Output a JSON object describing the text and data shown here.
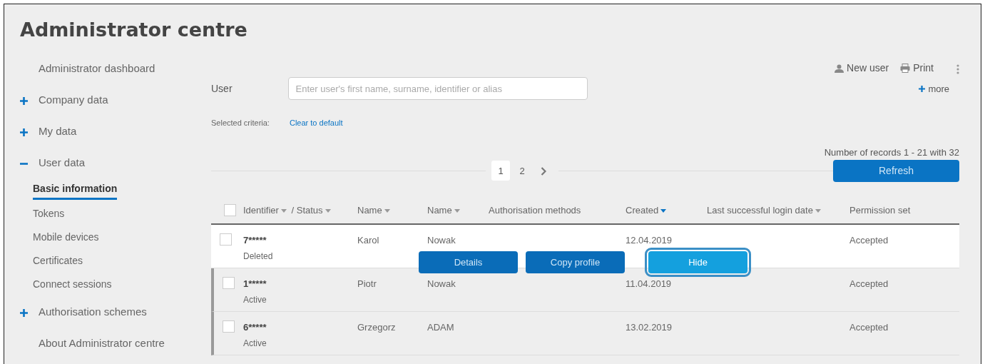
{
  "title": "Administrator centre",
  "sidebar": {
    "items": [
      {
        "kind": "link",
        "label": "Administrator dashboard"
      },
      {
        "kind": "group",
        "label": "Company data",
        "expanded": false
      },
      {
        "kind": "group",
        "label": "My data",
        "expanded": false
      },
      {
        "kind": "group",
        "label": "User data",
        "expanded": true,
        "children": [
          {
            "label": "Basic information",
            "selected": true
          },
          {
            "label": "Tokens",
            "selected": false
          },
          {
            "label": "Mobile devices",
            "selected": false
          },
          {
            "label": "Certificates",
            "selected": false
          },
          {
            "label": "Connect sessions",
            "selected": false
          }
        ]
      },
      {
        "kind": "group",
        "label": "Authorisation schemes",
        "expanded": false
      },
      {
        "kind": "link",
        "label": "About Administrator centre"
      }
    ]
  },
  "toolbar": {
    "actions": [
      {
        "kind": "user",
        "label": "New user"
      },
      {
        "kind": "print",
        "label": "Print"
      },
      {
        "kind": "menu"
      }
    ],
    "more": "more"
  },
  "filter": {
    "label": "User",
    "placeholder": "Enter user's first name, surname, identifier or alias",
    "criteria_label": "Selected criteria:",
    "clear_link": "Clear to default"
  },
  "records_info": "Number of records 1 - 21 with 32",
  "pagination": {
    "pages": [
      {
        "label": "1",
        "selected": true
      },
      {
        "label": "2",
        "selected": false
      }
    ]
  },
  "refresh_button": "Refresh",
  "table": {
    "select_all_checked": false,
    "columns": [
      {
        "parts": [
          {
            "label": "Identifier",
            "sortable": true,
            "sorted": false
          },
          {
            "label": "/ Status",
            "sortable": true,
            "sorted": false
          }
        ]
      },
      {
        "parts": [
          {
            "label": "Name",
            "sortable": true,
            "sorted": false
          }
        ]
      },
      {
        "parts": [
          {
            "label": "Name",
            "sortable": true,
            "sorted": false
          }
        ]
      },
      {
        "parts": [
          {
            "label": "Authorisation methods",
            "sortable": false,
            "sorted": false
          }
        ]
      },
      {
        "parts": [
          {
            "label": "Created",
            "sortable": true,
            "sorted": true
          }
        ]
      },
      {
        "parts": [
          {
            "label": "Last successful login date",
            "sortable": true,
            "sorted": false
          }
        ]
      },
      {
        "parts": [
          {
            "label": "Permission set",
            "sortable": false,
            "sorted": false
          }
        ]
      }
    ],
    "rows": [
      {
        "checked": false,
        "highlighted": true,
        "identifier": "7*****",
        "status": "Deleted",
        "first_name": "Karol",
        "last_name": "Nowak",
        "created": "12.04.2019",
        "permission_set": "Accepted"
      },
      {
        "checked": false,
        "highlighted": false,
        "identifier": "1*****",
        "status": "Active",
        "first_name": "Piotr",
        "last_name": "Nowak",
        "created": "11.04.2019",
        "permission_set": "Accepted"
      },
      {
        "checked": false,
        "highlighted": false,
        "identifier": "6*****",
        "status": "Active",
        "first_name": "Grzegorz",
        "last_name": "ADAM",
        "created": "13.02.2019",
        "permission_set": "Accepted"
      }
    ],
    "row_actions": [
      {
        "label": "Details",
        "focused": false
      },
      {
        "label": "Copy profile",
        "focused": false
      },
      {
        "label": "Hide",
        "focused": true
      }
    ]
  }
}
